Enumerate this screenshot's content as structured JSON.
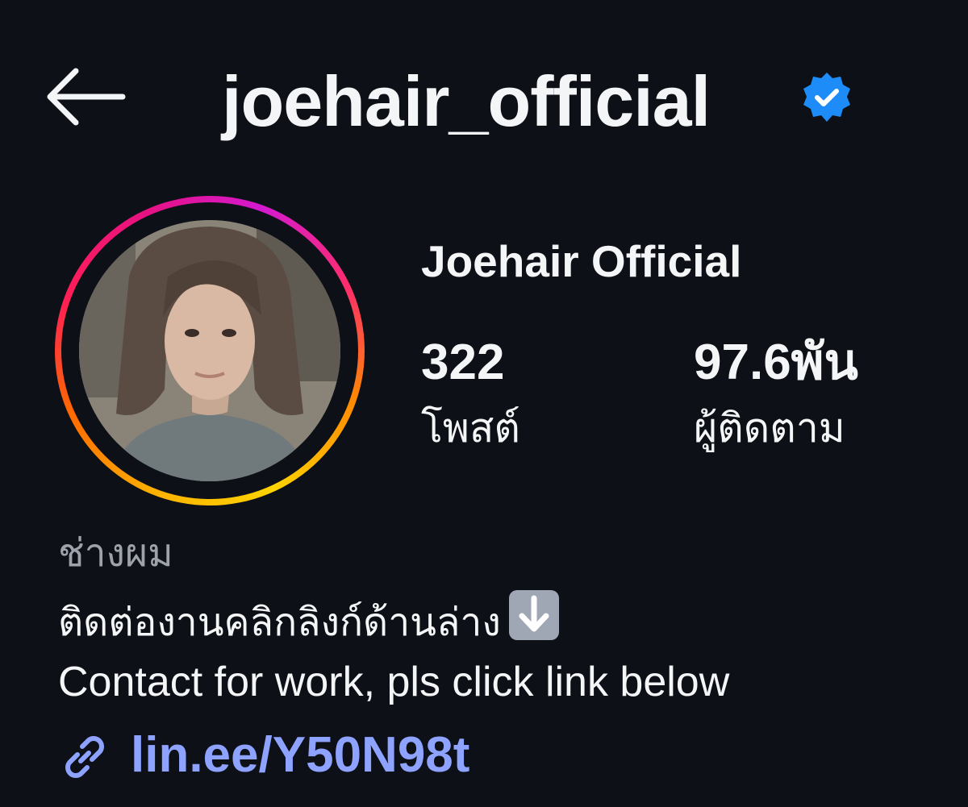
{
  "header": {
    "back_icon": "arrow-left-icon",
    "username": "joehair_official",
    "verified_icon": "verified-badge-icon",
    "verified_color": "#1d8cf8"
  },
  "profile": {
    "avatar_icon": "profile-photo",
    "ring_colors": [
      "#ffb300",
      "#ff1e56",
      "#d41ad0"
    ],
    "display_name": "Joehair Official",
    "stats": {
      "posts": {
        "value": "322",
        "label": "โพสต์"
      },
      "followers": {
        "value": "97.6พัน",
        "label": "ผู้ติดตาม"
      }
    }
  },
  "bio": {
    "category": "ช่างผม",
    "line_th": "ติดต่องานคลิกลิงก์ด้านล่าง",
    "emoji_icon": "down-arrow-emoji-icon",
    "line_en": "Contact for work, pls click link below",
    "link_icon": "link-icon",
    "link_text": "lin.ee/Y50N98t",
    "link_color": "#8ea2ff"
  }
}
